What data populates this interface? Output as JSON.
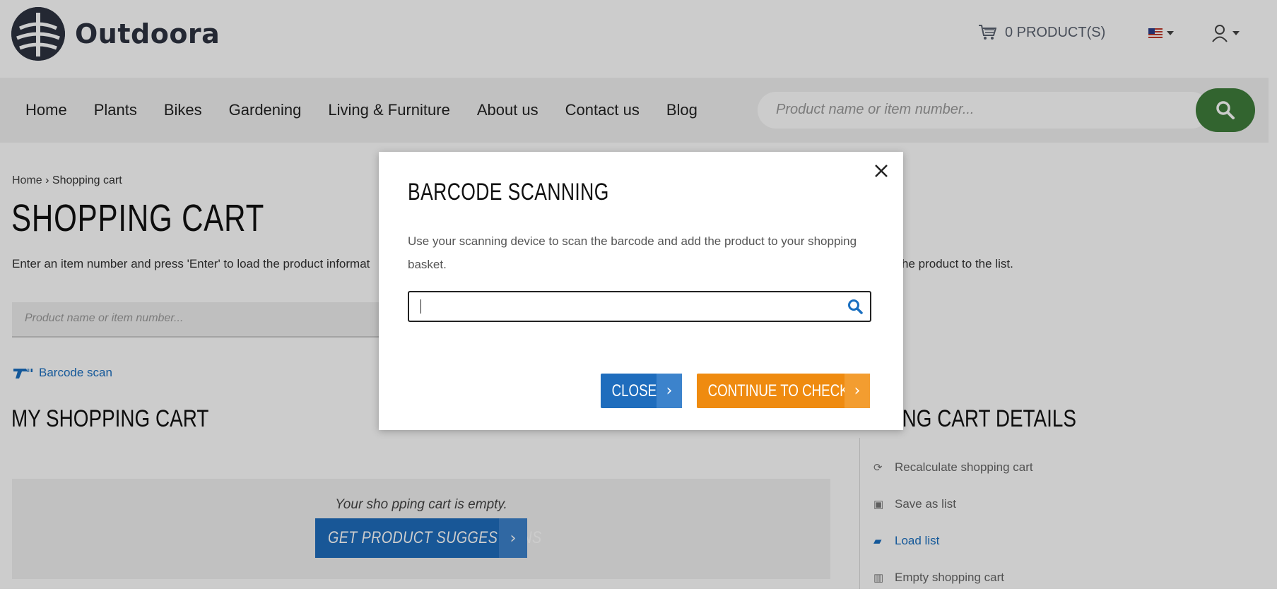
{
  "brand": {
    "name": "Outdoora"
  },
  "header": {
    "cart_label": "0 PRODUCT(S)",
    "flag_icon": "us-flag-icon",
    "user_icon": "user-icon"
  },
  "nav": {
    "items": [
      "Home",
      "Plants",
      "Bikes",
      "Gardening",
      "Living & Furniture",
      "About us",
      "Contact us",
      "Blog"
    ],
    "search_placeholder": "Product name or item number..."
  },
  "breadcrumb": {
    "home": "Home",
    "separator": "›",
    "current": "Shopping cart"
  },
  "page": {
    "title": "SHOPPING CART",
    "intro": "Enter an item number and press 'Enter' to load the product informat",
    "intro_tail": "he product to the list.",
    "search_placeholder": "Product name or item number...",
    "barcode_link": "Barcode scan",
    "my_cart_title": "MY SHOPPING CART",
    "empty_text": "Your sho pping cart is empty.",
    "suggest_button": "GET PRODUCT SUGGESTIONS"
  },
  "sidebar": {
    "title": "OPPING CART DETAILS",
    "items": [
      {
        "label": "Recalculate shopping cart",
        "icon": "refresh-icon"
      },
      {
        "label": "Save as list",
        "icon": "save-icon"
      },
      {
        "label": "Load list",
        "icon": "folder-open-icon"
      },
      {
        "label": "Empty shopping cart",
        "icon": "trash-icon"
      }
    ]
  },
  "modal": {
    "title": "BARCODE SCANNING",
    "text": "Use your scanning device to scan the barcode and add the product to your shopping basket.",
    "input_value": "",
    "close_button": "CLOSE",
    "checkout_button": "CONTINUE TO CHECKOUT",
    "chevron": "›"
  },
  "colors": {
    "brand_dark": "#2d3340",
    "search_green": "#3f7d3b",
    "primary_blue": "#1f6dbd",
    "checkout_orange": "#ef8b10"
  }
}
